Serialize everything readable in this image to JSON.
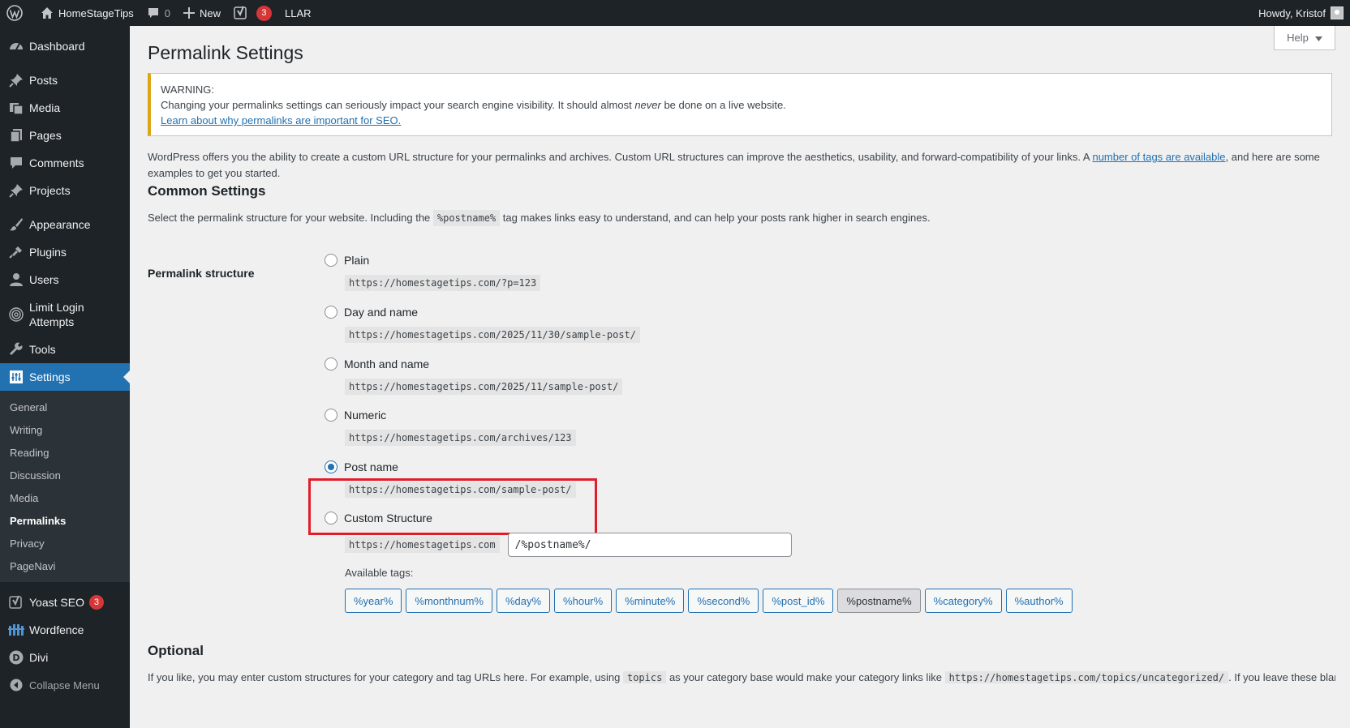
{
  "adminbar": {
    "site_name": "HomeStageTips",
    "comments_count": "0",
    "new_label": "New",
    "yoast_count": "3",
    "llar_label": "LLAR",
    "howdy": "Howdy, Kristof"
  },
  "sidebar": {
    "items": [
      {
        "label": "Dashboard"
      },
      {
        "label": "Posts"
      },
      {
        "label": "Media"
      },
      {
        "label": "Pages"
      },
      {
        "label": "Comments"
      },
      {
        "label": "Projects"
      },
      {
        "label": "Appearance"
      },
      {
        "label": "Plugins"
      },
      {
        "label": "Users"
      },
      {
        "label": "Limit Login Attempts"
      },
      {
        "label": "Tools"
      },
      {
        "label": "Settings"
      },
      {
        "label": "Yoast SEO",
        "count": "3"
      },
      {
        "label": "Wordfence"
      },
      {
        "label": "Divi"
      },
      {
        "label": "Collapse Menu"
      }
    ],
    "settings_submenu": [
      "General",
      "Writing",
      "Reading",
      "Discussion",
      "Media",
      "Permalinks",
      "Privacy",
      "PageNavi"
    ]
  },
  "main": {
    "help_label": "Help",
    "title": "Permalink Settings",
    "notice": {
      "heading": "WARNING:",
      "text_before": "Changing your permalinks settings can seriously impact your search engine visibility. It should almost ",
      "text_em": "never",
      "text_after": " be done on a live website.",
      "link": "Learn about why permalinks are important for SEO."
    },
    "intro": {
      "before": "WordPress offers you the ability to create a custom URL structure for your permalinks and archives. Custom URL structures can improve the aesthetics, usability, and forward-compatibility of your links. A ",
      "link": "number of tags are available",
      "after": ", and here are some examples to get you started."
    },
    "common_heading": "Common Settings",
    "common_desc_before": "Select the permalink structure for your website. Including the ",
    "common_desc_code": "%postname%",
    "common_desc_after": " tag makes links easy to understand, and can help your posts rank higher in search engines.",
    "structure_label": "Permalink structure",
    "options": [
      {
        "label": "Plain",
        "url": "https://homestagetips.com/?p=123",
        "checked": false
      },
      {
        "label": "Day and name",
        "url": "https://homestagetips.com/2025/11/30/sample-post/",
        "checked": false
      },
      {
        "label": "Month and name",
        "url": "https://homestagetips.com/2025/11/sample-post/",
        "checked": false
      },
      {
        "label": "Numeric",
        "url": "https://homestagetips.com/archives/123",
        "checked": false
      },
      {
        "label": "Post name",
        "url": "https://homestagetips.com/sample-post/",
        "checked": true
      },
      {
        "label": "Custom Structure",
        "url": "https://homestagetips.com",
        "checked": false
      }
    ],
    "custom_value": "/%postname%/",
    "available_tags_label": "Available tags:",
    "tags": [
      "%year%",
      "%monthnum%",
      "%day%",
      "%hour%",
      "%minute%",
      "%second%",
      "%post_id%",
      "%postname%",
      "%category%",
      "%author%"
    ],
    "active_tag": "%postname%",
    "optional_heading": "Optional",
    "optional_desc_before": "If you like, you may enter custom structures for your category and tag URLs here. For example, using ",
    "optional_code1": "topics",
    "optional_desc_mid": " as your category base would make your category links like ",
    "optional_code2": "https://homestagetips.com/topics/uncategorized/",
    "optional_desc_after": ". If you leave these blank"
  },
  "colors": {
    "admin_dark": "#1d2327",
    "accent": "#2271b1",
    "warning": "#dba617",
    "highlight": "#e11d2a"
  }
}
